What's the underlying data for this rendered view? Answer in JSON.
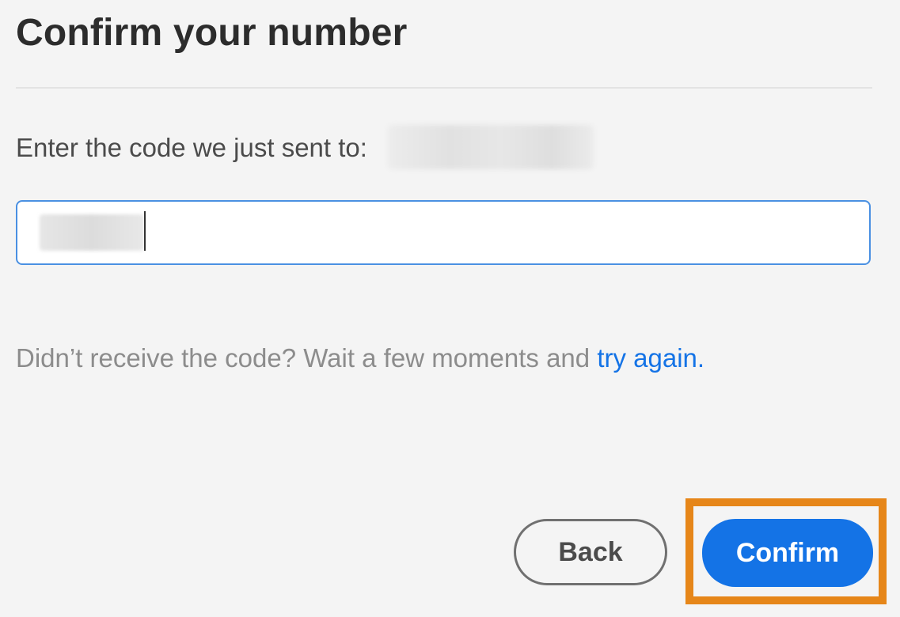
{
  "header": {
    "title": "Confirm your number"
  },
  "prompt": {
    "text": "Enter the code we just sent to:",
    "phone_number": "(redacted)"
  },
  "code_field": {
    "value": "",
    "placeholder": ""
  },
  "help": {
    "text": "Didn’t receive the code? Wait a few moments and ",
    "link_label": "try again."
  },
  "actions": {
    "back_label": "Back",
    "confirm_label": "Confirm"
  },
  "colors": {
    "accent": "#1473e6",
    "highlight": "#e68619",
    "background": "#f4f4f4"
  }
}
